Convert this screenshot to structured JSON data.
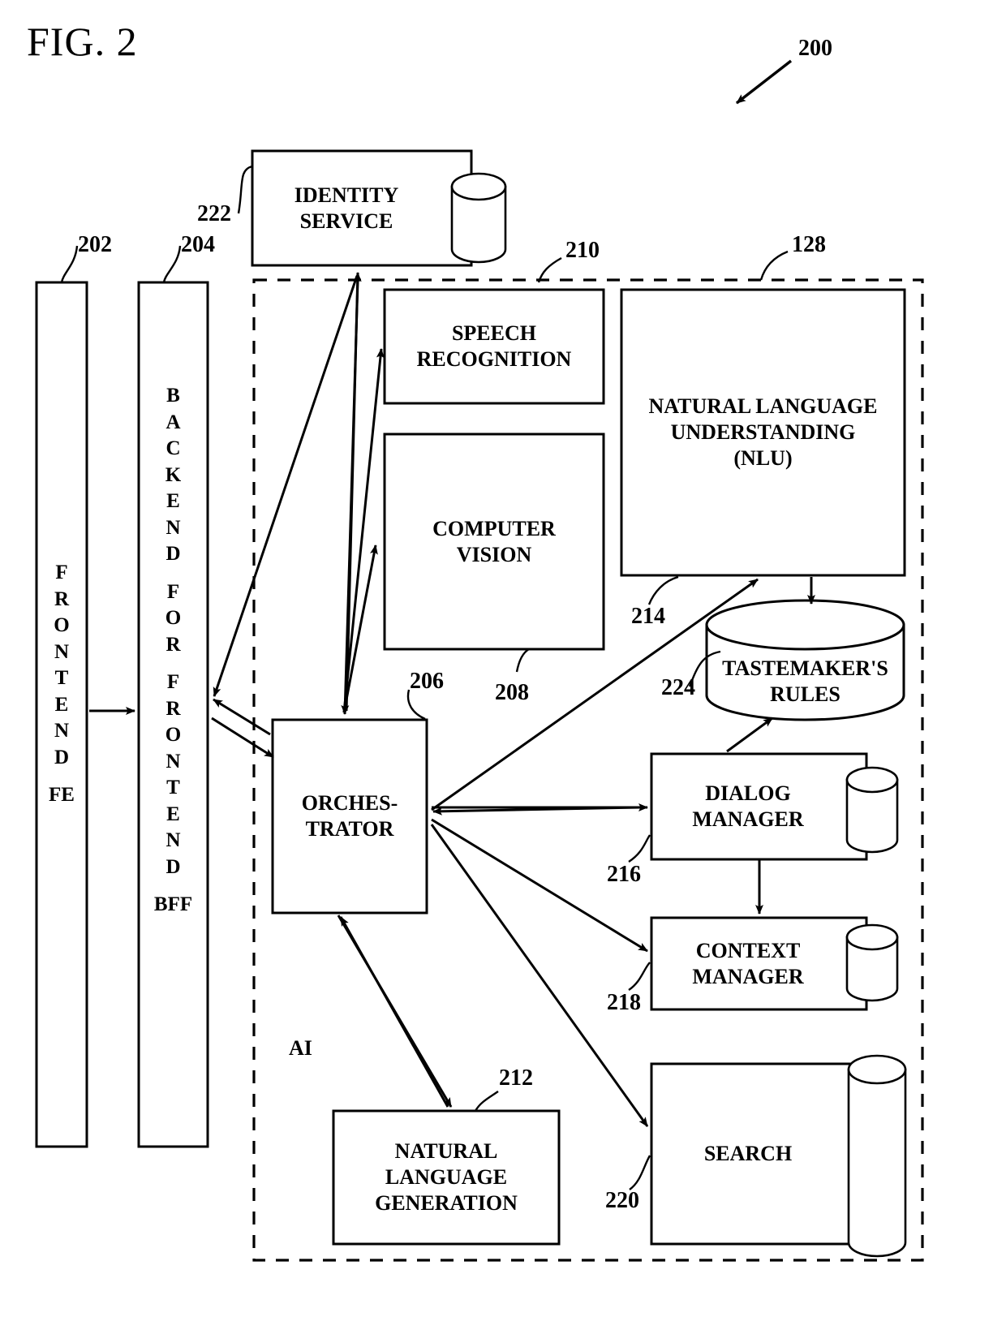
{
  "figure": {
    "title": "FIG. 2",
    "system_ref": "200",
    "ai_group_label": "AI",
    "ai_group_ref": "128"
  },
  "nodes": {
    "frontend": {
      "label_vertical": "FRONTEND",
      "label_abbrev": "FE",
      "ref": "202"
    },
    "bff": {
      "label_vertical_1": "BACKEND",
      "label_vertical_2": "FOR",
      "label_vertical_3": "FRONTEND",
      "label_abbrev": "BFF",
      "ref": "204"
    },
    "identity_service": {
      "label": "IDENTITY\nSERVICE",
      "ref": "222",
      "has_database": true
    },
    "speech_recognition": {
      "label": "SPEECH\nRECOGNITION",
      "ref": "210"
    },
    "computer_vision": {
      "label": "COMPUTER\nVISION",
      "ref": "208"
    },
    "nlu": {
      "label": "NATURAL LANGUAGE\nUNDERSTANDING\n(NLU)",
      "ref": "214"
    },
    "tastemakers_rules": {
      "label": "TASTEMAKER'S\nRULES",
      "ref": "224",
      "shape": "cylinder"
    },
    "orchestrator": {
      "label": "ORCHES-\nTRATOR",
      "ref": "206"
    },
    "dialog_manager": {
      "label": "DIALOG\nMANAGER",
      "ref": "216",
      "has_database": true
    },
    "context_manager": {
      "label": "CONTEXT\nMANAGER",
      "ref": "218",
      "has_database": true
    },
    "search": {
      "label": "SEARCH",
      "ref": "220",
      "has_database": true
    },
    "nlg": {
      "label": "NATURAL\nLANGUAGE\nGENERATION",
      "ref": "212"
    }
  },
  "colors": {
    "stroke": "#000000",
    "background": "#ffffff"
  }
}
